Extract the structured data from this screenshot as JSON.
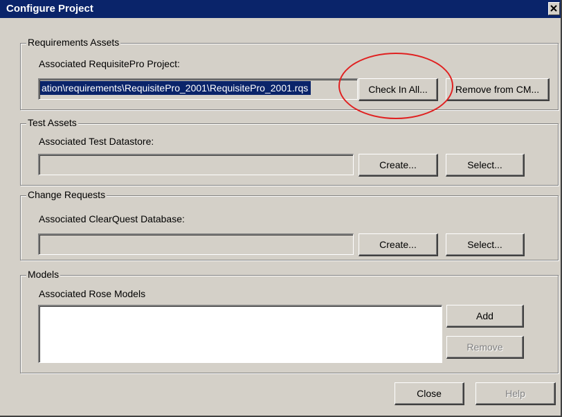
{
  "window": {
    "title": "Configure Project",
    "close_glyph": "✕"
  },
  "requirements": {
    "legend": "Requirements Assets",
    "label": "Associated RequisitePro Project:",
    "value": "ation\\requirements\\RequisitePro_2001\\RequisitePro_2001.rqs",
    "check_in_label": "Check In All...",
    "remove_label": "Remove from CM..."
  },
  "test": {
    "legend": "Test Assets",
    "label": "Associated Test Datastore:",
    "value": "",
    "create_label": "Create...",
    "select_label": "Select..."
  },
  "change": {
    "legend": "Change Requests",
    "label": "Associated ClearQuest Database:",
    "value": "",
    "create_label": "Create...",
    "select_label": "Select..."
  },
  "models": {
    "legend": "Models",
    "label": "Associated Rose Models",
    "items": [],
    "add_label": "Add",
    "remove_label": "Remove"
  },
  "footer": {
    "close_label": "Close",
    "help_label": "Help"
  },
  "colors": {
    "titlebar": "#0a246a",
    "dialog": "#d4d0c8",
    "annotation": "#e02020"
  }
}
